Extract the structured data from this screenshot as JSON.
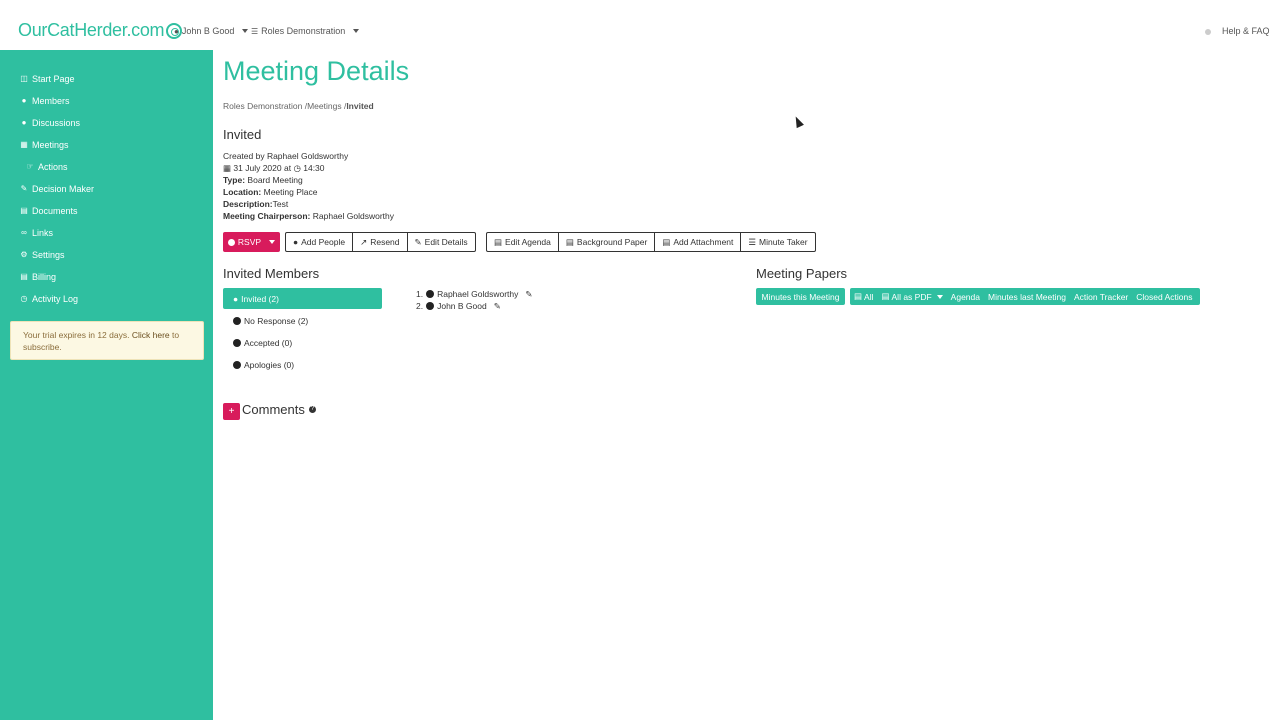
{
  "header": {
    "logo_text": "OurCatHerder.com",
    "user": "John B Good",
    "organisation": "Roles Demonstration",
    "help": "Help & FAQ"
  },
  "sidebar": {
    "items": [
      {
        "label": "Start Page",
        "icon": "dashboard-icon"
      },
      {
        "label": "Members",
        "icon": "user-icon"
      },
      {
        "label": "Discussions",
        "icon": "users-icon"
      },
      {
        "label": "Meetings",
        "icon": "calendar-icon"
      },
      {
        "label": "Actions",
        "icon": "hand-icon"
      },
      {
        "label": "Decision Maker",
        "icon": "pencil-icon"
      },
      {
        "label": "Documents",
        "icon": "document-icon"
      },
      {
        "label": "Links",
        "icon": "link-icon"
      },
      {
        "label": "Settings",
        "icon": "gears-icon"
      },
      {
        "label": "Billing",
        "icon": "billing-icon"
      },
      {
        "label": "Activity Log",
        "icon": "clock-icon"
      }
    ],
    "trial_text": "Your trial expires in 12 days.",
    "trial_link": "Click here",
    "trial_suffix": "to subscribe."
  },
  "page": {
    "title": "Meeting Details",
    "breadcrumb": [
      "Roles Demonstration /",
      "Meetings /",
      "Invited"
    ],
    "subtitle": "Invited",
    "created_by": "Created by Raphael Goldsworthy",
    "date": "31 July 2020 at",
    "time": "14:30",
    "type_label": "Type:",
    "type_value": "Board Meeting",
    "location_label": "Location:",
    "location_value": "Meeting Place",
    "description_label": "Description:",
    "description_value": "Test",
    "chair_label": "Meeting Chairperson:",
    "chair_value": "Raphael Goldsworthy"
  },
  "actions": {
    "rsvp": "RSVP",
    "group1": [
      "Add People",
      "Resend",
      "Edit Details"
    ],
    "group2": [
      "Edit Agenda",
      "Background Paper",
      "Add Attachment",
      "Minute Taker"
    ]
  },
  "invited_members": {
    "heading": "Invited Members",
    "filters": [
      "Invited (2)",
      "No Response (2)",
      "Accepted (0)",
      "Apologies (0)"
    ],
    "members": [
      "Raphael Goldsworthy",
      "John B Good"
    ]
  },
  "meeting_papers": {
    "heading": "Meeting Papers",
    "minutes_this": "Minutes this Meeting",
    "buttons": [
      "All",
      "All as PDF",
      "Agenda",
      "Minutes last Meeting",
      "Action Tracker",
      "Closed Actions"
    ]
  },
  "comments": {
    "plus": "+",
    "heading": "Comments",
    "help": "?"
  },
  "colors": {
    "accent": "#2fbfa0",
    "danger": "#d81b5c",
    "warning_bg": "#fcf8e3"
  }
}
